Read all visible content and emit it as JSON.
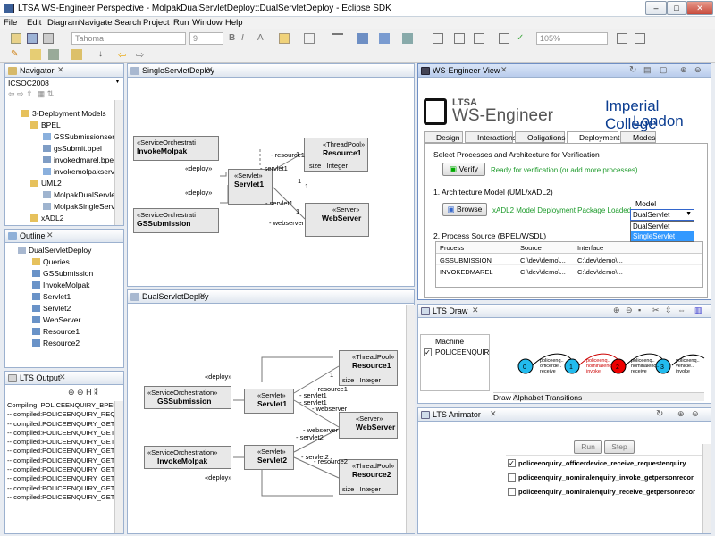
{
  "window": {
    "title": "LTSA WS-Engineer Perspective - MolpakDualServletDeploy::DualServletDeploy - Eclipse SDK",
    "min": "–",
    "max": "□",
    "close": "✕"
  },
  "menu": [
    "File",
    "Edit",
    "Diagram",
    "Navigate",
    "Search",
    "Project",
    "Run",
    "Window",
    "Help"
  ],
  "toolbar": {
    "font": "Tahoma",
    "size": "9",
    "zoom": "105%"
  },
  "navigator": {
    "title": "Navigator",
    "root": "ICSOC2008",
    "items": [
      "3-Deployment Models",
      "BPEL",
      "GSSubmissionservic",
      "gsSubmit.bpel",
      "invokedmarel.bpel",
      "invokemolpakservic",
      "UML2",
      "MolpakDualServlet",
      "MolpakSingleServle",
      "xADL2"
    ]
  },
  "outline": {
    "title": "Outline",
    "items": [
      "DualServletDeploy",
      "Queries",
      "GSSubmission",
      "InvokeMolpak",
      "Servlet1",
      "Servlet2",
      "WebServer",
      "Resource1",
      "Resource2"
    ]
  },
  "ltsoutput": {
    "title": "LTS Output",
    "lines": [
      "Compiling: POLICEENQUIRY_BPEL",
      "-- compiled:POLICEENQUIRY_REQ",
      "-- compiled:POLICEENQUIRY_GETI",
      "-- compiled:POLICEENQUIRY_GETV",
      "-- compiled:POLICEENQUIRY_GETV",
      "-- compiled:POLICEENQUIRY_GETV",
      "-- compiled:POLICEENQUIRY_GETV",
      "-- compiled:POLICEENQUIRY_GETV",
      "-- compiled:POLICEENQUIRY_GETV",
      "-- compiled:POLICEENQUIRY_GETV",
      "-- compiled:POLICEENQUIRY_GETV"
    ]
  },
  "single": {
    "title": "SingleServletDeploy",
    "orch1": {
      "st": "«ServiceOrchestrati",
      "nm": "InvokeMolpak"
    },
    "orch2": {
      "st": "«ServiceOrchestrati",
      "nm": "GSSubmission"
    },
    "servlet": {
      "st": "«Servlet»",
      "nm": "Servlet1"
    },
    "pool": {
      "st": "«ThreadPool»",
      "nm": "Resource1",
      "attr": "size : Integer"
    },
    "server": {
      "st": "«Server»",
      "nm": "WebServer"
    },
    "labels": {
      "deploy1": "«deploy»",
      "deploy2": "«deploy»",
      "res": "- resource1",
      "sv1": "- servlet1",
      "sv1b": "- servlet1",
      "ws": "- webserver",
      "one1": "1",
      "one2": "1",
      "one3": "1",
      "one4": "1"
    }
  },
  "dual": {
    "title": "DualServletDeploy",
    "orch1": {
      "st": "«ServiceOrchestration»",
      "nm": "GSSubmission"
    },
    "orch2": {
      "st": "«ServiceOrchestration»",
      "nm": "InvokeMolpak"
    },
    "s1": {
      "st": "«Servlet»",
      "nm": "Servlet1"
    },
    "s2": {
      "st": "«Servlet»",
      "nm": "Servlet2"
    },
    "pool1": {
      "st": "«ThreadPool»",
      "nm": "Resource1",
      "attr": "size : Integer"
    },
    "pool2": {
      "st": "«ThreadPool»",
      "nm": "Resource2",
      "attr": "size : Integer"
    },
    "server": {
      "st": "«Server»",
      "nm": "WebServer"
    },
    "labels": {
      "deploy1": "«deploy»",
      "deploy2": "«deploy»",
      "res1": "- resource1",
      "sv1a": "- servlet1",
      "sv1b": "- servlet1",
      "ws1": "- webserver",
      "ws2": "- webserver",
      "sv2a": "- servlet2",
      "sv2b": "- servlet2",
      "res2": "- resource2",
      "one": "1"
    }
  },
  "wse": {
    "title": "WS-Engineer View",
    "logo1": "LTSA",
    "logo2": "WS-Engineer",
    "imp1": "Imperial College",
    "imp2": "London",
    "tabs": [
      "Design",
      "Interactions",
      "Obligations",
      "Deployment",
      "Modes"
    ],
    "section": "Select Processes and Architecture for Verification",
    "verify": "Verify",
    "verifymsg": "Ready for verification (or add more processes).",
    "arch": "1. Architecture Model (UML/xADL2)",
    "browse": "Browse",
    "browsemsg": "xADL2 Model Deployment Package Loaded.",
    "modellbl": "Model",
    "model": "DualServlet",
    "options": [
      "DualServlet",
      "SingleServlet"
    ],
    "proc": "2. Process Source (BPEL/WSDL)",
    "cols": [
      "Process",
      "Source",
      "Interface"
    ],
    "rows": [
      [
        "GSSUBMISSION",
        "C:\\dev\\demo\\...",
        "C:\\dev\\demo\\..."
      ],
      [
        "INVOKEDMAREL",
        "C:\\dev\\demo\\...",
        "C:\\dev\\demo\\..."
      ]
    ]
  },
  "draw": {
    "title": "LTS Draw",
    "machine": "Machine",
    "entry": "POLICEENQUIRY_O",
    "states": [
      "0",
      "1",
      "2",
      "3"
    ],
    "edges": [
      "policeenq.. officerde.. receive",
      "policeenq.. nominalenq.. invoke",
      "policeenq.. nominalenq.. receive",
      "policeenq.. vehicle.. invoke"
    ],
    "tabs": [
      "Draw",
      "Alphabet",
      "Transitions"
    ]
  },
  "anim": {
    "title": "LTS Animator",
    "run": "Run",
    "step": "Step",
    "items": [
      "policeenquiry_officerdevice_receive_requestenquiry",
      "policeenquiry_nominalenquiry_invoke_getpersonrecor",
      "policeenquiry_nominalenquiry_receive_getpersonrecor"
    ]
  }
}
